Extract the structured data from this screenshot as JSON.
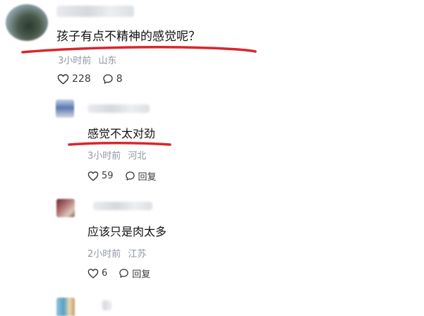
{
  "comments": [
    {
      "text": "孩子有点不精神的感觉呢？",
      "time": "3小时前",
      "location": "山东",
      "likes": "228",
      "replies": "8"
    },
    {
      "text": "感觉不太对劲",
      "time": "3小时前",
      "location": "河北",
      "likes": "59",
      "reply_label": "回复"
    },
    {
      "text": "应该只是肉太多",
      "time": "2小时前",
      "location": "江苏",
      "likes": "6",
      "reply_label": "回复"
    }
  ],
  "colors": {
    "annotation_red": "#d9262c",
    "meta_gray": "#8f96a3"
  },
  "icons": [
    "heart-icon",
    "comment-bubble-icon",
    "reply-icon"
  ]
}
